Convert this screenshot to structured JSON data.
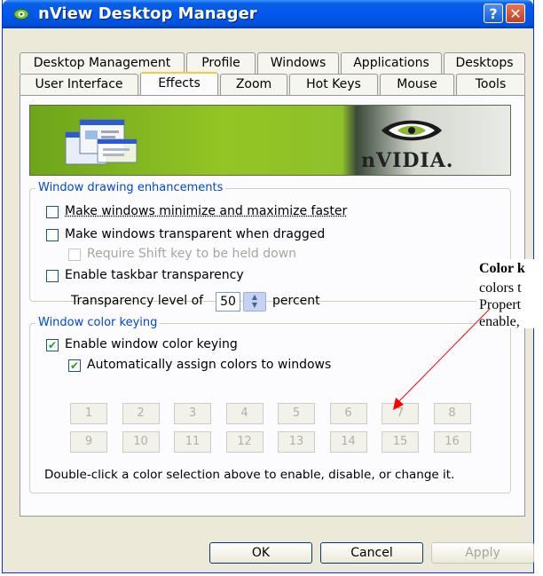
{
  "window": {
    "title": "nView Desktop Manager",
    "help_label": "?",
    "close_label": "✕"
  },
  "tabs": {
    "row1": [
      {
        "label": "Desktop Management"
      },
      {
        "label": "Profile"
      },
      {
        "label": "Windows"
      },
      {
        "label": "Applications"
      },
      {
        "label": "Desktops"
      }
    ],
    "row2": [
      {
        "label": "User Interface"
      },
      {
        "label": "Effects",
        "active": true
      },
      {
        "label": "Zoom"
      },
      {
        "label": "Hot Keys"
      },
      {
        "label": "Mouse"
      },
      {
        "label": "Tools"
      }
    ]
  },
  "banner": {
    "brand_text": "nVIDIA.",
    "icon": "nvidia-eye-logo"
  },
  "drawing": {
    "group_label": "Window drawing enhancements",
    "options": [
      {
        "label": "Make windows minimize and maximize faster",
        "checked": false,
        "enabled": true
      },
      {
        "label": "Make windows transparent when dragged",
        "checked": false,
        "enabled": true
      },
      {
        "label": "Require Shift key to be held down",
        "checked": false,
        "enabled": false
      },
      {
        "label": "Enable taskbar transparency",
        "checked": false,
        "enabled": true
      }
    ],
    "transparency": {
      "prefix": "Transparency level of",
      "value": "50",
      "suffix": "percent"
    }
  },
  "keying": {
    "group_label": "Window color keying",
    "options": [
      {
        "label": "Enable window color keying",
        "checked": true
      },
      {
        "label": "Automatically assign colors to windows",
        "checked": true
      }
    ],
    "colors_row1": [
      "1",
      "2",
      "3",
      "4",
      "5",
      "6",
      "7",
      "8"
    ],
    "colors_row2": [
      "9",
      "10",
      "11",
      "12",
      "13",
      "14",
      "15",
      "16"
    ],
    "help_text": "Double-click a color selection above to enable, disable, or change it."
  },
  "buttons": {
    "ok": "OK",
    "cancel": "Cancel",
    "apply": "Apply"
  },
  "annotation": {
    "title": "Color k",
    "lines": [
      "colors t",
      "Propert",
      "enable,"
    ],
    "color": "#ff0000"
  },
  "colors": {
    "titlebar": "#0058ee",
    "dialog_bg": "#ece9d8",
    "group_label": "#0046d5",
    "check_mark": "#21a121",
    "active_tab_accent": "#ffc73c"
  }
}
